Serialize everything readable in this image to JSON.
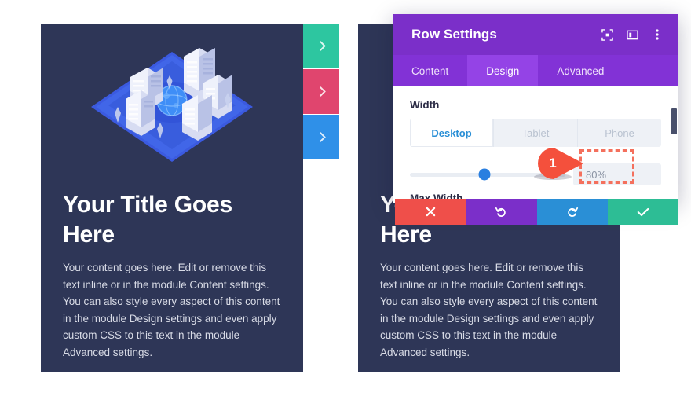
{
  "colors": {
    "card_bg": "#2e3657",
    "page_bg": "#ffffff",
    "panel_header": "#7b2fc9",
    "panel_tabs": "#8232d6",
    "panel_tab_active": "#9443e6",
    "accent_blue": "#2a7fe0",
    "callout_red": "#f4503c",
    "highlight_dashed": "#f4705d",
    "tab_teal": "#2dc6a0",
    "tab_pink": "#e0456e",
    "tab_blue": "#2f90e8",
    "btn_cancel": "#ef4f4a",
    "btn_undo": "#7b2fc9",
    "btn_redo": "#2a8fd6",
    "btn_save": "#2dbd95"
  },
  "cards": [
    {
      "name": "left-card",
      "title": "Your Title Goes Here",
      "body": "Your content goes here. Edit or remove this text inline or in the module Content settings. You can also style every aspect of this content in the module Design settings and even apply custom CSS to this text in the module Advanced settings.",
      "illustration": "isometric-city-illustration"
    },
    {
      "name": "right-card",
      "title": "Your Title Goes Here",
      "body": "Your content goes here. Edit or remove this text inline or in the module Content settings. You can also style every aspect of this content in the module Design settings and even apply custom CSS to this text in the module Advanced settings.",
      "illustration": "isometric-city-illustration"
    }
  ],
  "side_tabs": [
    {
      "name": "side-tab-1",
      "color": "#2dc6a0",
      "icon": "chevron-right-icon"
    },
    {
      "name": "side-tab-2",
      "color": "#e0456e",
      "icon": "chevron-right-icon"
    },
    {
      "name": "side-tab-3",
      "color": "#2f90e8",
      "icon": "chevron-right-icon"
    }
  ],
  "settings_panel": {
    "title": "Row Settings",
    "header_icons": [
      {
        "name": "expand-view-icon",
        "label": "expand"
      },
      {
        "name": "layout-panel-icon",
        "label": "layout"
      },
      {
        "name": "kebab-menu-icon",
        "label": "more"
      }
    ],
    "tabs": [
      {
        "label": "Content",
        "active": false
      },
      {
        "label": "Design",
        "active": true
      },
      {
        "label": "Advanced",
        "active": false
      }
    ],
    "width_section": {
      "label": "Width",
      "devices": [
        {
          "label": "Desktop",
          "active": true
        },
        {
          "label": "Tablet",
          "active": false
        },
        {
          "label": "Phone",
          "active": false
        }
      ],
      "slider": {
        "value": "80%",
        "percent": 80
      }
    },
    "next_section_label": "Max Width",
    "actions": [
      {
        "name": "cancel-button",
        "icon": "close-icon",
        "color": "#ef4f4a"
      },
      {
        "name": "undo-button",
        "icon": "undo-icon",
        "color": "#7b2fc9"
      },
      {
        "name": "redo-button",
        "icon": "redo-icon",
        "color": "#2a8fd6"
      },
      {
        "name": "save-button",
        "icon": "check-icon",
        "color": "#2dbd95"
      }
    ]
  },
  "callout": {
    "number": "1",
    "points_to": "width-value-input"
  }
}
